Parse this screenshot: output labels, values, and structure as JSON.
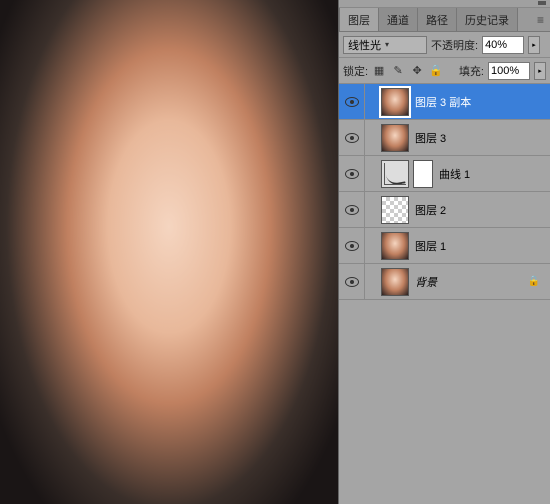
{
  "tabs": {
    "layers": "图层",
    "channels": "通道",
    "paths": "路径",
    "history": "历史记录"
  },
  "blend": {
    "mode": "线性光",
    "opacity_label": "不透明度:",
    "opacity_value": "40%"
  },
  "lock_row": {
    "lock_label": "锁定:",
    "fill_label": "填充:",
    "fill_value": "100%"
  },
  "layers": [
    {
      "name": "图层 3 副本",
      "type": "photo",
      "selected": true
    },
    {
      "name": "图层 3",
      "type": "photo",
      "selected": false
    },
    {
      "name": "曲线 1",
      "type": "curves",
      "selected": false
    },
    {
      "name": "图层 2",
      "type": "checker",
      "selected": false
    },
    {
      "name": "图层 1",
      "type": "photo",
      "selected": false
    },
    {
      "name": "背景",
      "type": "photo",
      "selected": false,
      "locked": true
    }
  ]
}
